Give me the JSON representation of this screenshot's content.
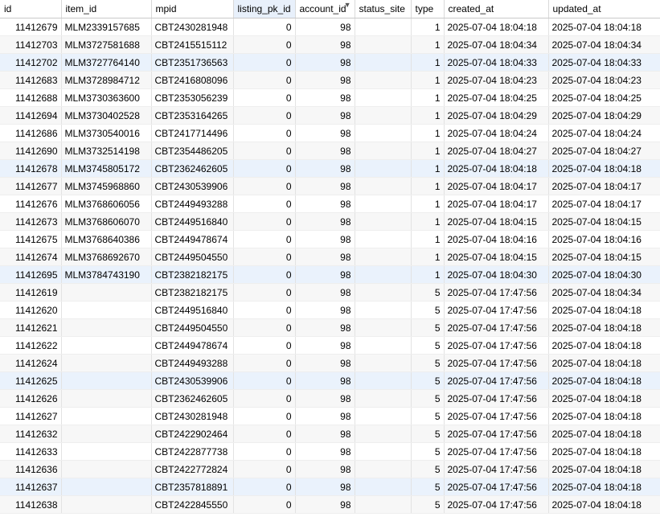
{
  "table": {
    "columns": [
      "id",
      "item_id",
      "mpid",
      "listing_pk_id",
      "account_id",
      "status_site",
      "type",
      "created_at",
      "updated_at"
    ],
    "sort_icon": "sort-desc-icon",
    "rows": [
      [
        "11412679",
        "MLM2339157685",
        "CBT2430281948",
        "0",
        "98",
        "",
        "1",
        "2025-07-04 18:04:18",
        "2025-07-04 18:04:18"
      ],
      [
        "11412703",
        "MLM3727581688",
        "CBT2415515112",
        "0",
        "98",
        "",
        "1",
        "2025-07-04 18:04:34",
        "2025-07-04 18:04:34"
      ],
      [
        "11412702",
        "MLM3727764140",
        "CBT2351736563",
        "0",
        "98",
        "",
        "1",
        "2025-07-04 18:04:33",
        "2025-07-04 18:04:33"
      ],
      [
        "11412683",
        "MLM3728984712",
        "CBT2416808096",
        "0",
        "98",
        "",
        "1",
        "2025-07-04 18:04:23",
        "2025-07-04 18:04:23"
      ],
      [
        "11412688",
        "MLM3730363600",
        "CBT2353056239",
        "0",
        "98",
        "",
        "1",
        "2025-07-04 18:04:25",
        "2025-07-04 18:04:25"
      ],
      [
        "11412694",
        "MLM3730402528",
        "CBT2353164265",
        "0",
        "98",
        "",
        "1",
        "2025-07-04 18:04:29",
        "2025-07-04 18:04:29"
      ],
      [
        "11412686",
        "MLM3730540016",
        "CBT2417714496",
        "0",
        "98",
        "",
        "1",
        "2025-07-04 18:04:24",
        "2025-07-04 18:04:24"
      ],
      [
        "11412690",
        "MLM3732514198",
        "CBT2354486205",
        "0",
        "98",
        "",
        "1",
        "2025-07-04 18:04:27",
        "2025-07-04 18:04:27"
      ],
      [
        "11412678",
        "MLM3745805172",
        "CBT2362462605",
        "0",
        "98",
        "",
        "1",
        "2025-07-04 18:04:18",
        "2025-07-04 18:04:18"
      ],
      [
        "11412677",
        "MLM3745968860",
        "CBT2430539906",
        "0",
        "98",
        "",
        "1",
        "2025-07-04 18:04:17",
        "2025-07-04 18:04:17"
      ],
      [
        "11412676",
        "MLM3768606056",
        "CBT2449493288",
        "0",
        "98",
        "",
        "1",
        "2025-07-04 18:04:17",
        "2025-07-04 18:04:17"
      ],
      [
        "11412673",
        "MLM3768606070",
        "CBT2449516840",
        "0",
        "98",
        "",
        "1",
        "2025-07-04 18:04:15",
        "2025-07-04 18:04:15"
      ],
      [
        "11412675",
        "MLM3768640386",
        "CBT2449478674",
        "0",
        "98",
        "",
        "1",
        "2025-07-04 18:04:16",
        "2025-07-04 18:04:16"
      ],
      [
        "11412674",
        "MLM3768692670",
        "CBT2449504550",
        "0",
        "98",
        "",
        "1",
        "2025-07-04 18:04:15",
        "2025-07-04 18:04:15"
      ],
      [
        "11412695",
        "MLM3784743190",
        "CBT2382182175",
        "0",
        "98",
        "",
        "1",
        "2025-07-04 18:04:30",
        "2025-07-04 18:04:30"
      ],
      [
        "11412619",
        "",
        "CBT2382182175",
        "0",
        "98",
        "",
        "5",
        "2025-07-04 17:47:56",
        "2025-07-04 18:04:34"
      ],
      [
        "11412620",
        "",
        "CBT2449516840",
        "0",
        "98",
        "",
        "5",
        "2025-07-04 17:47:56",
        "2025-07-04 18:04:18"
      ],
      [
        "11412621",
        "",
        "CBT2449504550",
        "0",
        "98",
        "",
        "5",
        "2025-07-04 17:47:56",
        "2025-07-04 18:04:18"
      ],
      [
        "11412622",
        "",
        "CBT2449478674",
        "0",
        "98",
        "",
        "5",
        "2025-07-04 17:47:56",
        "2025-07-04 18:04:18"
      ],
      [
        "11412624",
        "",
        "CBT2449493288",
        "0",
        "98",
        "",
        "5",
        "2025-07-04 17:47:56",
        "2025-07-04 18:04:18"
      ],
      [
        "11412625",
        "",
        "CBT2430539906",
        "0",
        "98",
        "",
        "5",
        "2025-07-04 17:47:56",
        "2025-07-04 18:04:18"
      ],
      [
        "11412626",
        "",
        "CBT2362462605",
        "0",
        "98",
        "",
        "5",
        "2025-07-04 17:47:56",
        "2025-07-04 18:04:18"
      ],
      [
        "11412627",
        "",
        "CBT2430281948",
        "0",
        "98",
        "",
        "5",
        "2025-07-04 17:47:56",
        "2025-07-04 18:04:18"
      ],
      [
        "11412632",
        "",
        "CBT2422902464",
        "0",
        "98",
        "",
        "5",
        "2025-07-04 17:47:56",
        "2025-07-04 18:04:18"
      ],
      [
        "11412633",
        "",
        "CBT2422877738",
        "0",
        "98",
        "",
        "5",
        "2025-07-04 17:47:56",
        "2025-07-04 18:04:18"
      ],
      [
        "11412636",
        "",
        "CBT2422772824",
        "0",
        "98",
        "",
        "5",
        "2025-07-04 17:47:56",
        "2025-07-04 18:04:18"
      ],
      [
        "11412637",
        "",
        "CBT2357818891",
        "0",
        "98",
        "",
        "5",
        "2025-07-04 17:47:56",
        "2025-07-04 18:04:18"
      ],
      [
        "11412638",
        "",
        "CBT2422845550",
        "0",
        "98",
        "",
        "5",
        "2025-07-04 17:47:56",
        "2025-07-04 18:04:18"
      ]
    ]
  }
}
